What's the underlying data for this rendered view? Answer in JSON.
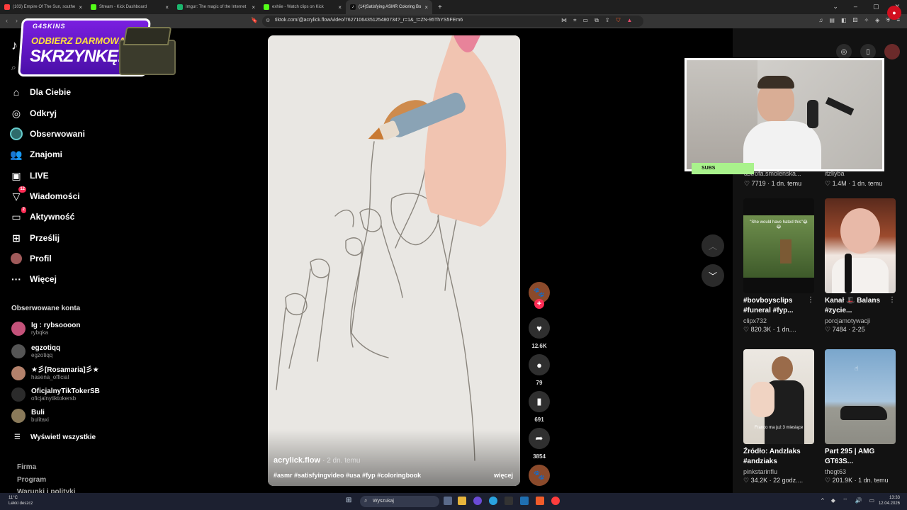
{
  "browser": {
    "tabs": [
      {
        "label": "(103) Empire Of The Sun, southe",
        "color": "#ff3d3d",
        "active": false
      },
      {
        "label": "Stream - Kick Dashboard",
        "color": "#53fc18",
        "active": false
      },
      {
        "label": "Imgur: The magic of the Internet",
        "color": "#1bb76e",
        "active": false
      },
      {
        "label": "exhiie - Watch clips on Kick",
        "color": "#53fc18",
        "active": false
      },
      {
        "label": "(14)Satisfying ASMR Coloring Bo",
        "color": "#ffffff",
        "active": true
      }
    ],
    "url": "tiktok.com/@acrylick.flow/video/7627106435125480734?_r=1&_t=ZN-95ThYS5FEm6"
  },
  "promo": {
    "brand": "G4SKINS",
    "line1": "ODBIERZ DARMOWĄ",
    "line2": "SKRZYNKĘ!"
  },
  "sidebar": {
    "nav": [
      {
        "label": "Dla Ciebie",
        "icon": "compass-icon"
      },
      {
        "label": "Odkryj",
        "icon": "explore-icon"
      },
      {
        "label": "Obserwowani",
        "icon": "following-avatar-icon"
      },
      {
        "label": "Znajomi",
        "icon": "friends-icon"
      },
      {
        "label": "LIVE",
        "icon": "live-icon"
      },
      {
        "label": "Wiadomości",
        "icon": "messages-icon",
        "badge": "12"
      },
      {
        "label": "Aktywność",
        "icon": "activity-icon",
        "badge": "2"
      },
      {
        "label": "Prześlij",
        "icon": "upload-icon"
      },
      {
        "label": "Profil",
        "icon": "profile-avatar-icon"
      },
      {
        "label": "Więcej",
        "icon": "more-icon"
      }
    ],
    "followed_title": "Obserwowane konta",
    "accounts": [
      {
        "name": "Ig : rybsoooon",
        "handle": "rybqka",
        "color": "#c4527a"
      },
      {
        "name": "egzotiqq",
        "handle": "egzotiqq",
        "color": "#555555"
      },
      {
        "name": "★彡[Rosamaria]彡★",
        "handle": "hasena_official",
        "color": "#b3816b"
      },
      {
        "name": "OficjalnyTikTokerSB",
        "handle": "oficjalnytiktokersb",
        "color": "#2b2b2b"
      },
      {
        "name": "Buli",
        "handle": "bulitaxi",
        "color": "#8a7a5a"
      }
    ],
    "show_all": "Wyświetl wszystkie",
    "footer": [
      "Firma",
      "Program",
      "Warunki i polityki"
    ]
  },
  "video": {
    "author": "acrylick.flow",
    "age": "· 2 dn. temu",
    "tags": "#asmr #satisfyingvideo #usa #fyp #coloringbook",
    "more": "więcej"
  },
  "actions": {
    "likes": "12.6K",
    "comments": "79",
    "saves": "691",
    "shares": "3854"
  },
  "webcam": {
    "label": "SUBS"
  },
  "right": {
    "partial": [
      {
        "author": "astrofa.smolenska...",
        "likes": "7719",
        "age": "1 dn. temu"
      },
      {
        "author": "itzliyba",
        "likes": "1.4M",
        "age": "1 dn. temu"
      }
    ],
    "cards": [
      {
        "title": "#bovboysclips #funeral #fyp...",
        "author": "clipx732",
        "likes": "820.3K",
        "age": "1 dn....",
        "overlay": "\"She would have hated this\"😂😂"
      },
      {
        "title": "Kanał 🎩 Balans #zycie...",
        "author": "porcjamotywacji",
        "likes": "7484",
        "age": "2-25",
        "overlay": ""
      },
      {
        "title": "Źródło: Andzlaks #andziaks",
        "author": "pinkstarinflu",
        "likes": "34.2K",
        "age": "22 godz....",
        "overlay": "Franco ma już 3 miesiące"
      },
      {
        "title": "Part 295 | AMG GT63S...",
        "author": "thegt63",
        "likes": "201.9K",
        "age": "1 dn. temu",
        "overlay": ""
      }
    ]
  },
  "taskbar": {
    "search": "Wyszukaj",
    "weather_temp": "11°C",
    "weather_desc": "Lekki deszcz",
    "time": "13:33",
    "date": "12.04.2026"
  }
}
